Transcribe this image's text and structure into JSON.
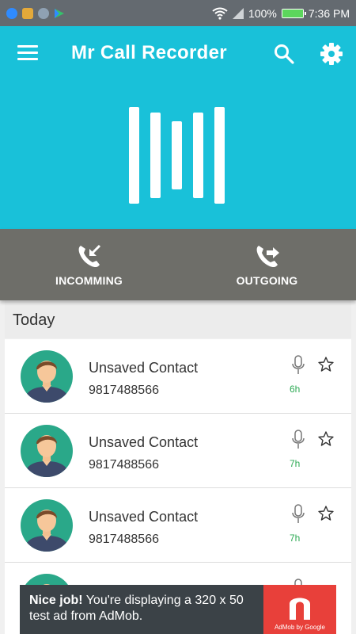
{
  "status_bar": {
    "battery_text": "100%",
    "battery_level": 1.0,
    "time": "7:36 PM",
    "icons": [
      "messenger-icon",
      "notification-icon",
      "lock-icon",
      "play-store-icon",
      "wifi-icon",
      "signal-icon",
      "battery-icon"
    ]
  },
  "toolbar": {
    "title": "Mr Call Recorder",
    "icons": [
      "menu-icon",
      "search-icon",
      "gear-icon"
    ]
  },
  "colors": {
    "header": "#19c1d9",
    "tabs": "#6e6e69",
    "duration": "#2eaa55",
    "avatar_bg": "#2aa889"
  },
  "tabs": [
    {
      "label": "INCOMMING",
      "icon": "incoming-call-icon"
    },
    {
      "label": "OUTGOING",
      "icon": "outgoing-call-icon"
    }
  ],
  "section": {
    "title": "Today"
  },
  "calls": [
    {
      "name": "Unsaved Contact",
      "number": "9817488566",
      "time": "6h"
    },
    {
      "name": "Unsaved Contact",
      "number": "9817488566",
      "time": "7h"
    },
    {
      "name": "Unsaved Contact",
      "number": "9817488566",
      "time": "7h"
    }
  ],
  "ad": {
    "bold": "Nice job!",
    "text": " You're displaying a 320 x 50 test ad from AdMob.",
    "brand": "AdMob by Google"
  }
}
